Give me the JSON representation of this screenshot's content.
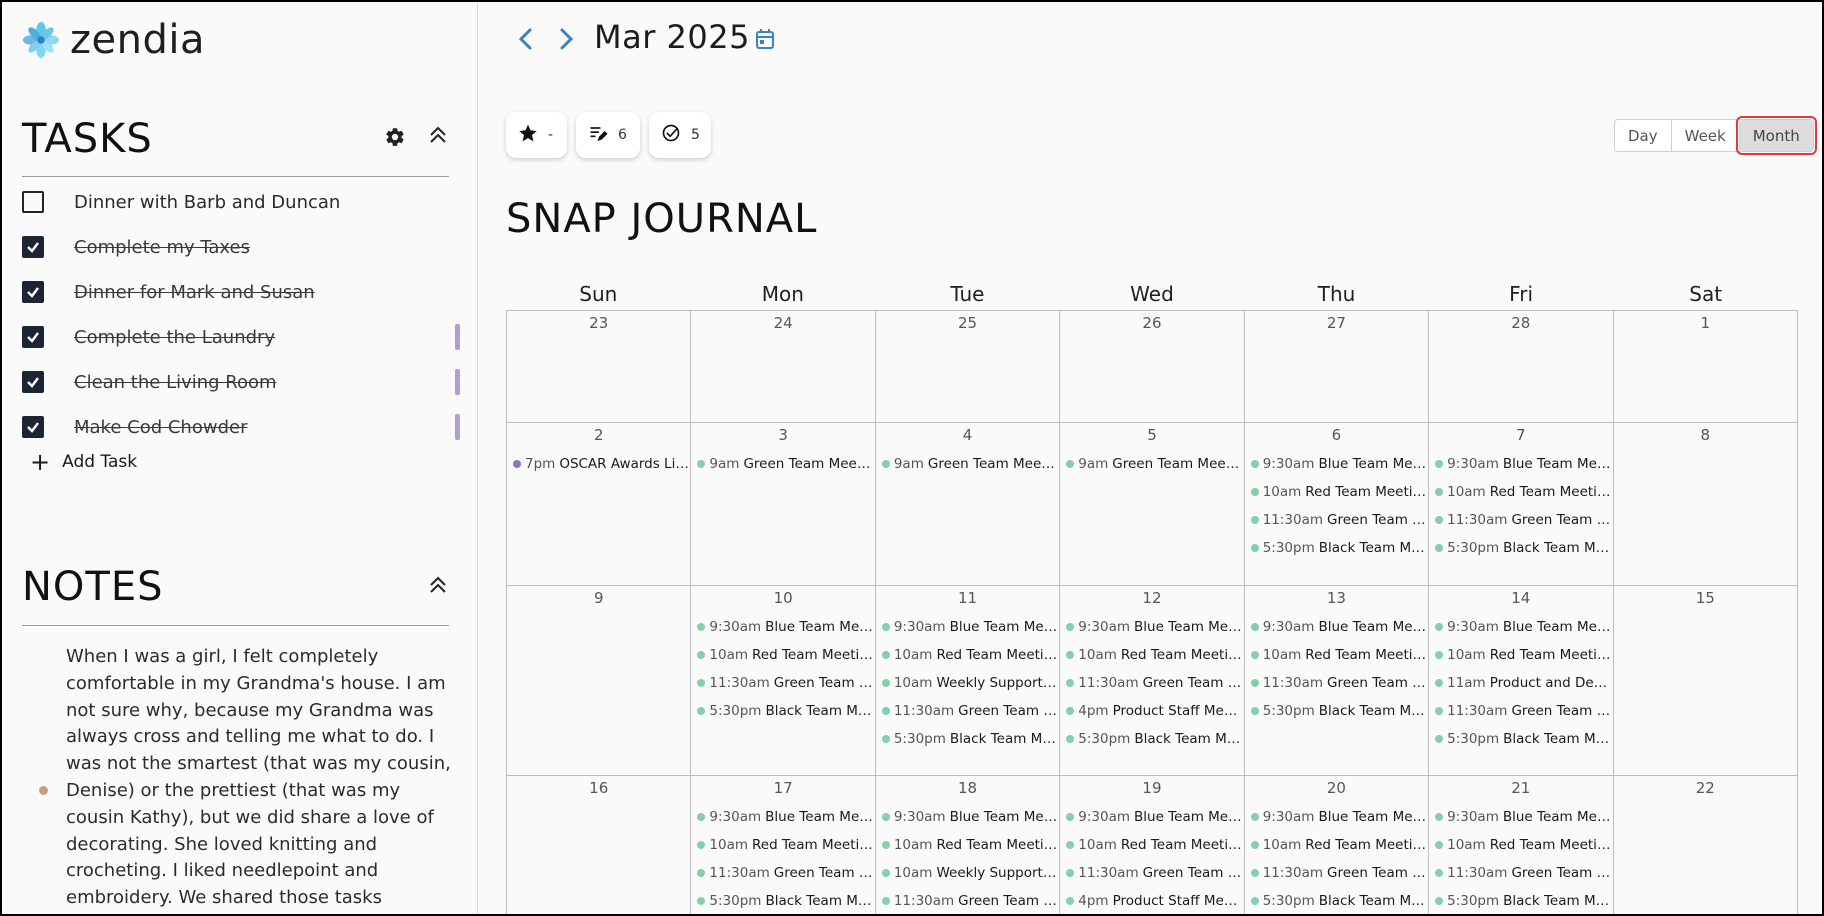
{
  "app": {
    "name": "zendia"
  },
  "tasks": {
    "title": "TASKS",
    "items": [
      {
        "label": "Dinner with Barb and Duncan",
        "done": false,
        "bar": false
      },
      {
        "label": "Complete my Taxes",
        "done": true,
        "bar": false
      },
      {
        "label": "Dinner for Mark and Susan",
        "done": true,
        "bar": false
      },
      {
        "label": "Complete the Laundry",
        "done": true,
        "bar": true
      },
      {
        "label": "Clean the Living Room",
        "done": true,
        "bar": true
      },
      {
        "label": "Make Cod Chowder",
        "done": true,
        "bar": true
      }
    ],
    "add_label": "Add Task",
    "bar_color": "#b39ccf"
  },
  "notes": {
    "title": "NOTES",
    "text": "When I was a girl, I felt completely comfortable in my Grandma's house. I am not sure why, because my Grandma was always cross and telling me what to do. I was not the smartest (that was my cousin, Denise) or the prettiest (that was my cousin Kathy), but we did share a love of decorating. She loved knitting and crocheting. I liked needlepoint and embroidery. We shared those tasks",
    "dot_color": "#c7a07a"
  },
  "header": {
    "month_label": "Mar 2025",
    "accent": "#3b82c4"
  },
  "stats": [
    {
      "icon": "star-icon",
      "value": "-"
    },
    {
      "icon": "edit-list-icon",
      "value": "6"
    },
    {
      "icon": "check-circle-icon",
      "value": "5"
    }
  ],
  "views": {
    "options": [
      "Day",
      "Week",
      "Month"
    ],
    "selected": "Month"
  },
  "journal": {
    "title": "SNAP JOURNAL"
  },
  "calendar": {
    "weekdays": [
      "Sun",
      "Mon",
      "Tue",
      "Wed",
      "Thu",
      "Fri",
      "Sat"
    ],
    "event_dot_color": "#86cfaa",
    "special_dot_color": "#8f73b8",
    "weeks": [
      [
        {
          "day": "23",
          "events": []
        },
        {
          "day": "24",
          "events": []
        },
        {
          "day": "25",
          "events": []
        },
        {
          "day": "26",
          "events": []
        },
        {
          "day": "27",
          "events": []
        },
        {
          "day": "28",
          "events": []
        },
        {
          "day": "1",
          "events": []
        }
      ],
      [
        {
          "day": "2",
          "events": [
            {
              "time": "7pm",
              "name": "OSCAR Awards Live",
              "purple": true
            }
          ]
        },
        {
          "day": "3",
          "events": [
            {
              "time": "9am",
              "name": "Green Team Meeting"
            }
          ]
        },
        {
          "day": "4",
          "events": [
            {
              "time": "9am",
              "name": "Green Team Meeting"
            }
          ]
        },
        {
          "day": "5",
          "events": [
            {
              "time": "9am",
              "name": "Green Team Meeting"
            }
          ]
        },
        {
          "day": "6",
          "events": [
            {
              "time": "9:30am",
              "name": "Blue Team Meeti..."
            },
            {
              "time": "10am",
              "name": "Red Team Meeting"
            },
            {
              "time": "11:30am",
              "name": "Green Team Me..."
            },
            {
              "time": "5:30pm",
              "name": "Black Team Mee..."
            }
          ]
        },
        {
          "day": "7",
          "events": [
            {
              "time": "9:30am",
              "name": "Blue Team Meeti..."
            },
            {
              "time": "10am",
              "name": "Red Team Meeting"
            },
            {
              "time": "11:30am",
              "name": "Green Team Me..."
            },
            {
              "time": "5:30pm",
              "name": "Black Team Mee..."
            }
          ]
        },
        {
          "day": "8",
          "events": []
        }
      ],
      [
        {
          "day": "9",
          "events": []
        },
        {
          "day": "10",
          "events": [
            {
              "time": "9:30am",
              "name": "Blue Team Meeti..."
            },
            {
              "time": "10am",
              "name": "Red Team Meeting"
            },
            {
              "time": "11:30am",
              "name": "Green Team Me..."
            },
            {
              "time": "5:30pm",
              "name": "Black Team Mee..."
            }
          ]
        },
        {
          "day": "11",
          "events": [
            {
              "time": "9:30am",
              "name": "Blue Team Meeti..."
            },
            {
              "time": "10am",
              "name": "Red Team Meeting"
            },
            {
              "time": "10am",
              "name": "Weekly Support M..."
            },
            {
              "time": "11:30am",
              "name": "Green Team Mee..."
            },
            {
              "time": "5:30pm",
              "name": "Black Team Mee..."
            }
          ]
        },
        {
          "day": "12",
          "events": [
            {
              "time": "9:30am",
              "name": "Blue Team Meeti..."
            },
            {
              "time": "10am",
              "name": "Red Team Meeting"
            },
            {
              "time": "11:30am",
              "name": "Green Team Me..."
            },
            {
              "time": "4pm",
              "name": "Product Staff Meeti..."
            },
            {
              "time": "5:30pm",
              "name": "Black Team Mee..."
            }
          ]
        },
        {
          "day": "13",
          "events": [
            {
              "time": "9:30am",
              "name": "Blue Team Meeti..."
            },
            {
              "time": "10am",
              "name": "Red Team Meeting"
            },
            {
              "time": "11:30am",
              "name": "Green Team Me..."
            },
            {
              "time": "5:30pm",
              "name": "Black Team Mee..."
            }
          ]
        },
        {
          "day": "14",
          "events": [
            {
              "time": "9:30am",
              "name": "Blue Team Meeti..."
            },
            {
              "time": "10am",
              "name": "Red Team Meeting"
            },
            {
              "time": "11am",
              "name": "Product and Devel..."
            },
            {
              "time": "11:30am",
              "name": "Green Team Me..."
            },
            {
              "time": "5:30pm",
              "name": "Black Team Mee..."
            }
          ]
        },
        {
          "day": "15",
          "events": []
        }
      ],
      [
        {
          "day": "16",
          "events": []
        },
        {
          "day": "17",
          "events": [
            {
              "time": "9:30am",
              "name": "Blue Team Meeti..."
            },
            {
              "time": "10am",
              "name": "Red Team Meeting"
            },
            {
              "time": "11:30am",
              "name": "Green Team Me..."
            },
            {
              "time": "5:30pm",
              "name": "Black Team Mee..."
            }
          ]
        },
        {
          "day": "18",
          "events": [
            {
              "time": "9:30am",
              "name": "Blue Team Meeti..."
            },
            {
              "time": "10am",
              "name": "Red Team Meeting"
            },
            {
              "time": "10am",
              "name": "Weekly Support M..."
            },
            {
              "time": "11:30am",
              "name": "Green Team Mee..."
            }
          ]
        },
        {
          "day": "19",
          "events": [
            {
              "time": "9:30am",
              "name": "Blue Team Meeti..."
            },
            {
              "time": "10am",
              "name": "Red Team Meeting"
            },
            {
              "time": "11:30am",
              "name": "Green Team Me..."
            },
            {
              "time": "4pm",
              "name": "Product Staff Meeti..."
            }
          ]
        },
        {
          "day": "20",
          "events": [
            {
              "time": "9:30am",
              "name": "Blue Team Meeti..."
            },
            {
              "time": "10am",
              "name": "Red Team Meeting"
            },
            {
              "time": "11:30am",
              "name": "Green Team Me..."
            },
            {
              "time": "5:30pm",
              "name": "Black Team Mee..."
            }
          ]
        },
        {
          "day": "21",
          "events": [
            {
              "time": "9:30am",
              "name": "Blue Team Meeti..."
            },
            {
              "time": "10am",
              "name": "Red Team Meeting"
            },
            {
              "time": "11:30am",
              "name": "Green Team Me..."
            },
            {
              "time": "5:30pm",
              "name": "Black Team Mee..."
            }
          ]
        },
        {
          "day": "22",
          "events": []
        }
      ]
    ]
  }
}
